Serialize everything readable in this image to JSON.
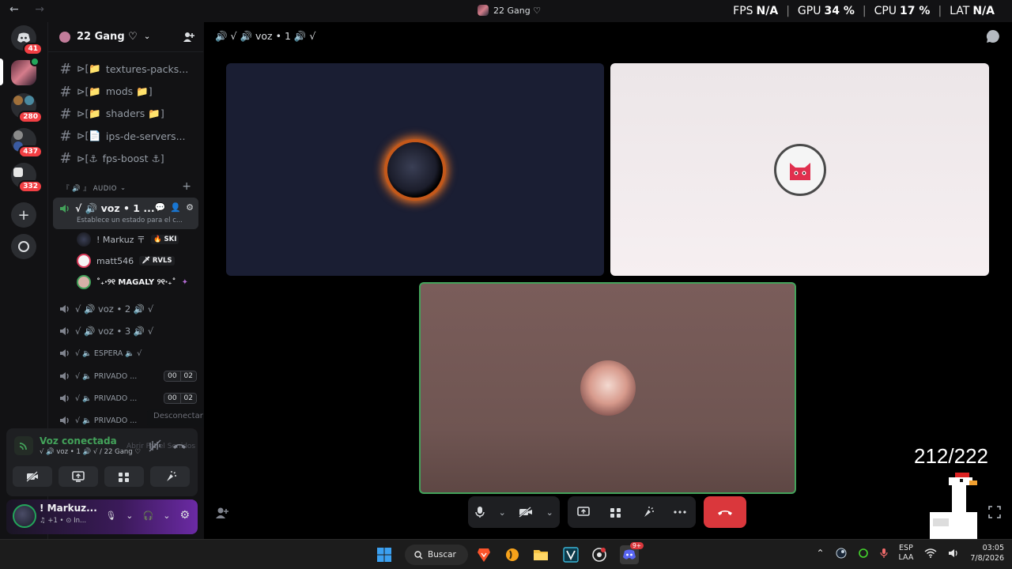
{
  "window": {
    "title": "22 Gang ♡",
    "nav_back": "←",
    "nav_forward": "→"
  },
  "overlay": {
    "fps_label": "FPS",
    "fps_value": "N/A",
    "gpu_label": "GPU",
    "gpu_value": "34 %",
    "cpu_label": "CPU",
    "cpu_value": "17 %",
    "lat_label": "LAT",
    "lat_value": "N/A"
  },
  "rail": {
    "home_badge": "41",
    "badges": [
      "280",
      "437",
      "332"
    ]
  },
  "guild": {
    "name": "22 Gang ♡",
    "channels": [
      {
        "prefix": "⊳[📁",
        "name": "textures-packs..."
      },
      {
        "prefix": "⊳[📁",
        "name": "mods 📁]"
      },
      {
        "prefix": "⊳[📁",
        "name": "shaders 📁]"
      },
      {
        "prefix": "⊳[📄",
        "name": "ips-de-servers..."
      },
      {
        "prefix": "⊳[⚓",
        "name": "fps-boost ⚓]"
      }
    ],
    "category": "『 🔊 』 AUDIO",
    "active_voice": {
      "name": "√ 🔊 voz • 1 ...",
      "status": "Establece un estado para el c..."
    },
    "members": [
      {
        "name": "! Markuz 〒",
        "tag": "🔥 SKI"
      },
      {
        "name": "matt546",
        "tag": "🗡 RVLS"
      },
      {
        "name": "˚₊‧୨୧ MAGALY ୨୧‧₊˚",
        "tag": "✦"
      }
    ],
    "voice_channels": [
      {
        "name": "√ 🔊 voz • 2 🔊 √"
      },
      {
        "name": "√ 🔊 voz • 3 🔊 √"
      },
      {
        "name": "√ 🔈 ESPERA 🔈 √"
      },
      {
        "name": "√ 🔈 PRIVADO ...",
        "count_a": "00",
        "count_b": "02"
      },
      {
        "name": "√ 🔈 PRIVADO ...",
        "count_a": "00",
        "count_b": "02"
      },
      {
        "name": "√ 🔈 PRIVADO ..."
      }
    ],
    "tooltip": "Desconectar"
  },
  "voice_panel": {
    "title": "Voz conectada",
    "subtitle": "√ 🔊 voz • 1 🔊 √ / 22 Gang ♡",
    "ghost_text": "Abrir Panel Sonidos"
  },
  "user": {
    "name": "! Markuz...",
    "sub": "♫ +1 • ⊙ In..."
  },
  "stage": {
    "channel_title": "🔊 √ 🔊 voz • 1 🔊 √",
    "viewer_count": "212/222"
  },
  "taskbar": {
    "search_label": "Buscar",
    "lang_top": "ESP",
    "lang_bottom": "LAA",
    "time": "03:05",
    "date": "7/8/2026",
    "discord_badge": "9+"
  },
  "colors": {
    "accent_green": "#43a25a",
    "danger_red": "#da373c",
    "badge_red": "#f23f43"
  }
}
